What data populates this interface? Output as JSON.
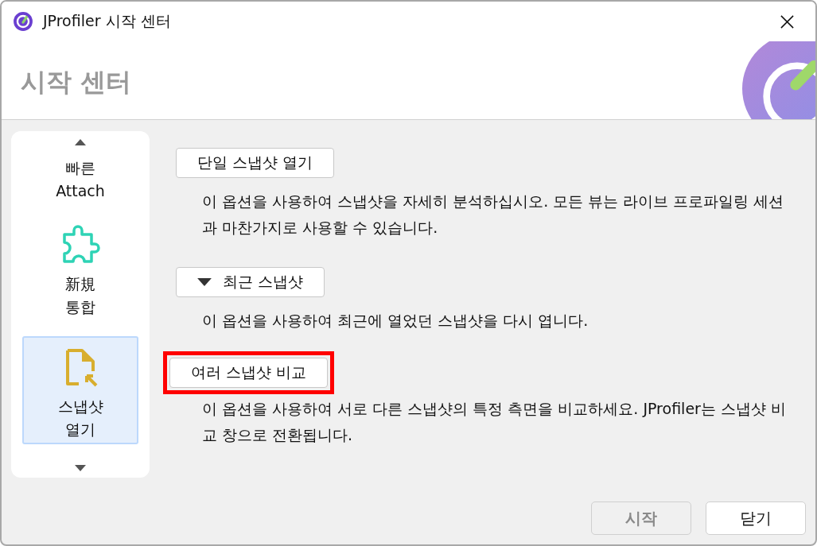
{
  "window": {
    "title": "JProfiler 시작 센터"
  },
  "header": {
    "title": "시작 센터"
  },
  "sidebar": {
    "items": [
      {
        "kind": "plain",
        "lines": [
          "빠른",
          "Attach"
        ],
        "selected": false
      },
      {
        "kind": "puzzle",
        "lines": [
          "新規",
          "통합"
        ],
        "selected": false
      },
      {
        "kind": "file",
        "lines": [
          "스냅샷",
          "열기"
        ],
        "selected": true
      }
    ]
  },
  "options": [
    {
      "kind": "plain",
      "label": "단일 스냅샷 열기",
      "highlighted": false,
      "description": "이 옵션을 사용하여 스냅샷을 자세히 분석하십시오. 모든 뷰는 라이브 프로파일링 세션과 마찬가지로 사용할 수 있습니다."
    },
    {
      "kind": "dropdown",
      "label": "최근 스냅샷",
      "highlighted": false,
      "description": "이 옵션을 사용하여 최근에 열었던 스냅샷을 다시 엽니다."
    },
    {
      "kind": "plain",
      "label": "여러 스냅샷 비교",
      "highlighted": true,
      "description": "이 옵션을 사용하여 서로 다른 스냅샷의 특정 측면을 비교하세요. JProfiler는 스냅샷 비교 창으로 전환됩니다."
    }
  ],
  "buttons": [
    {
      "label": "시작",
      "disabled": true
    },
    {
      "label": "닫기",
      "disabled": false
    }
  ]
}
